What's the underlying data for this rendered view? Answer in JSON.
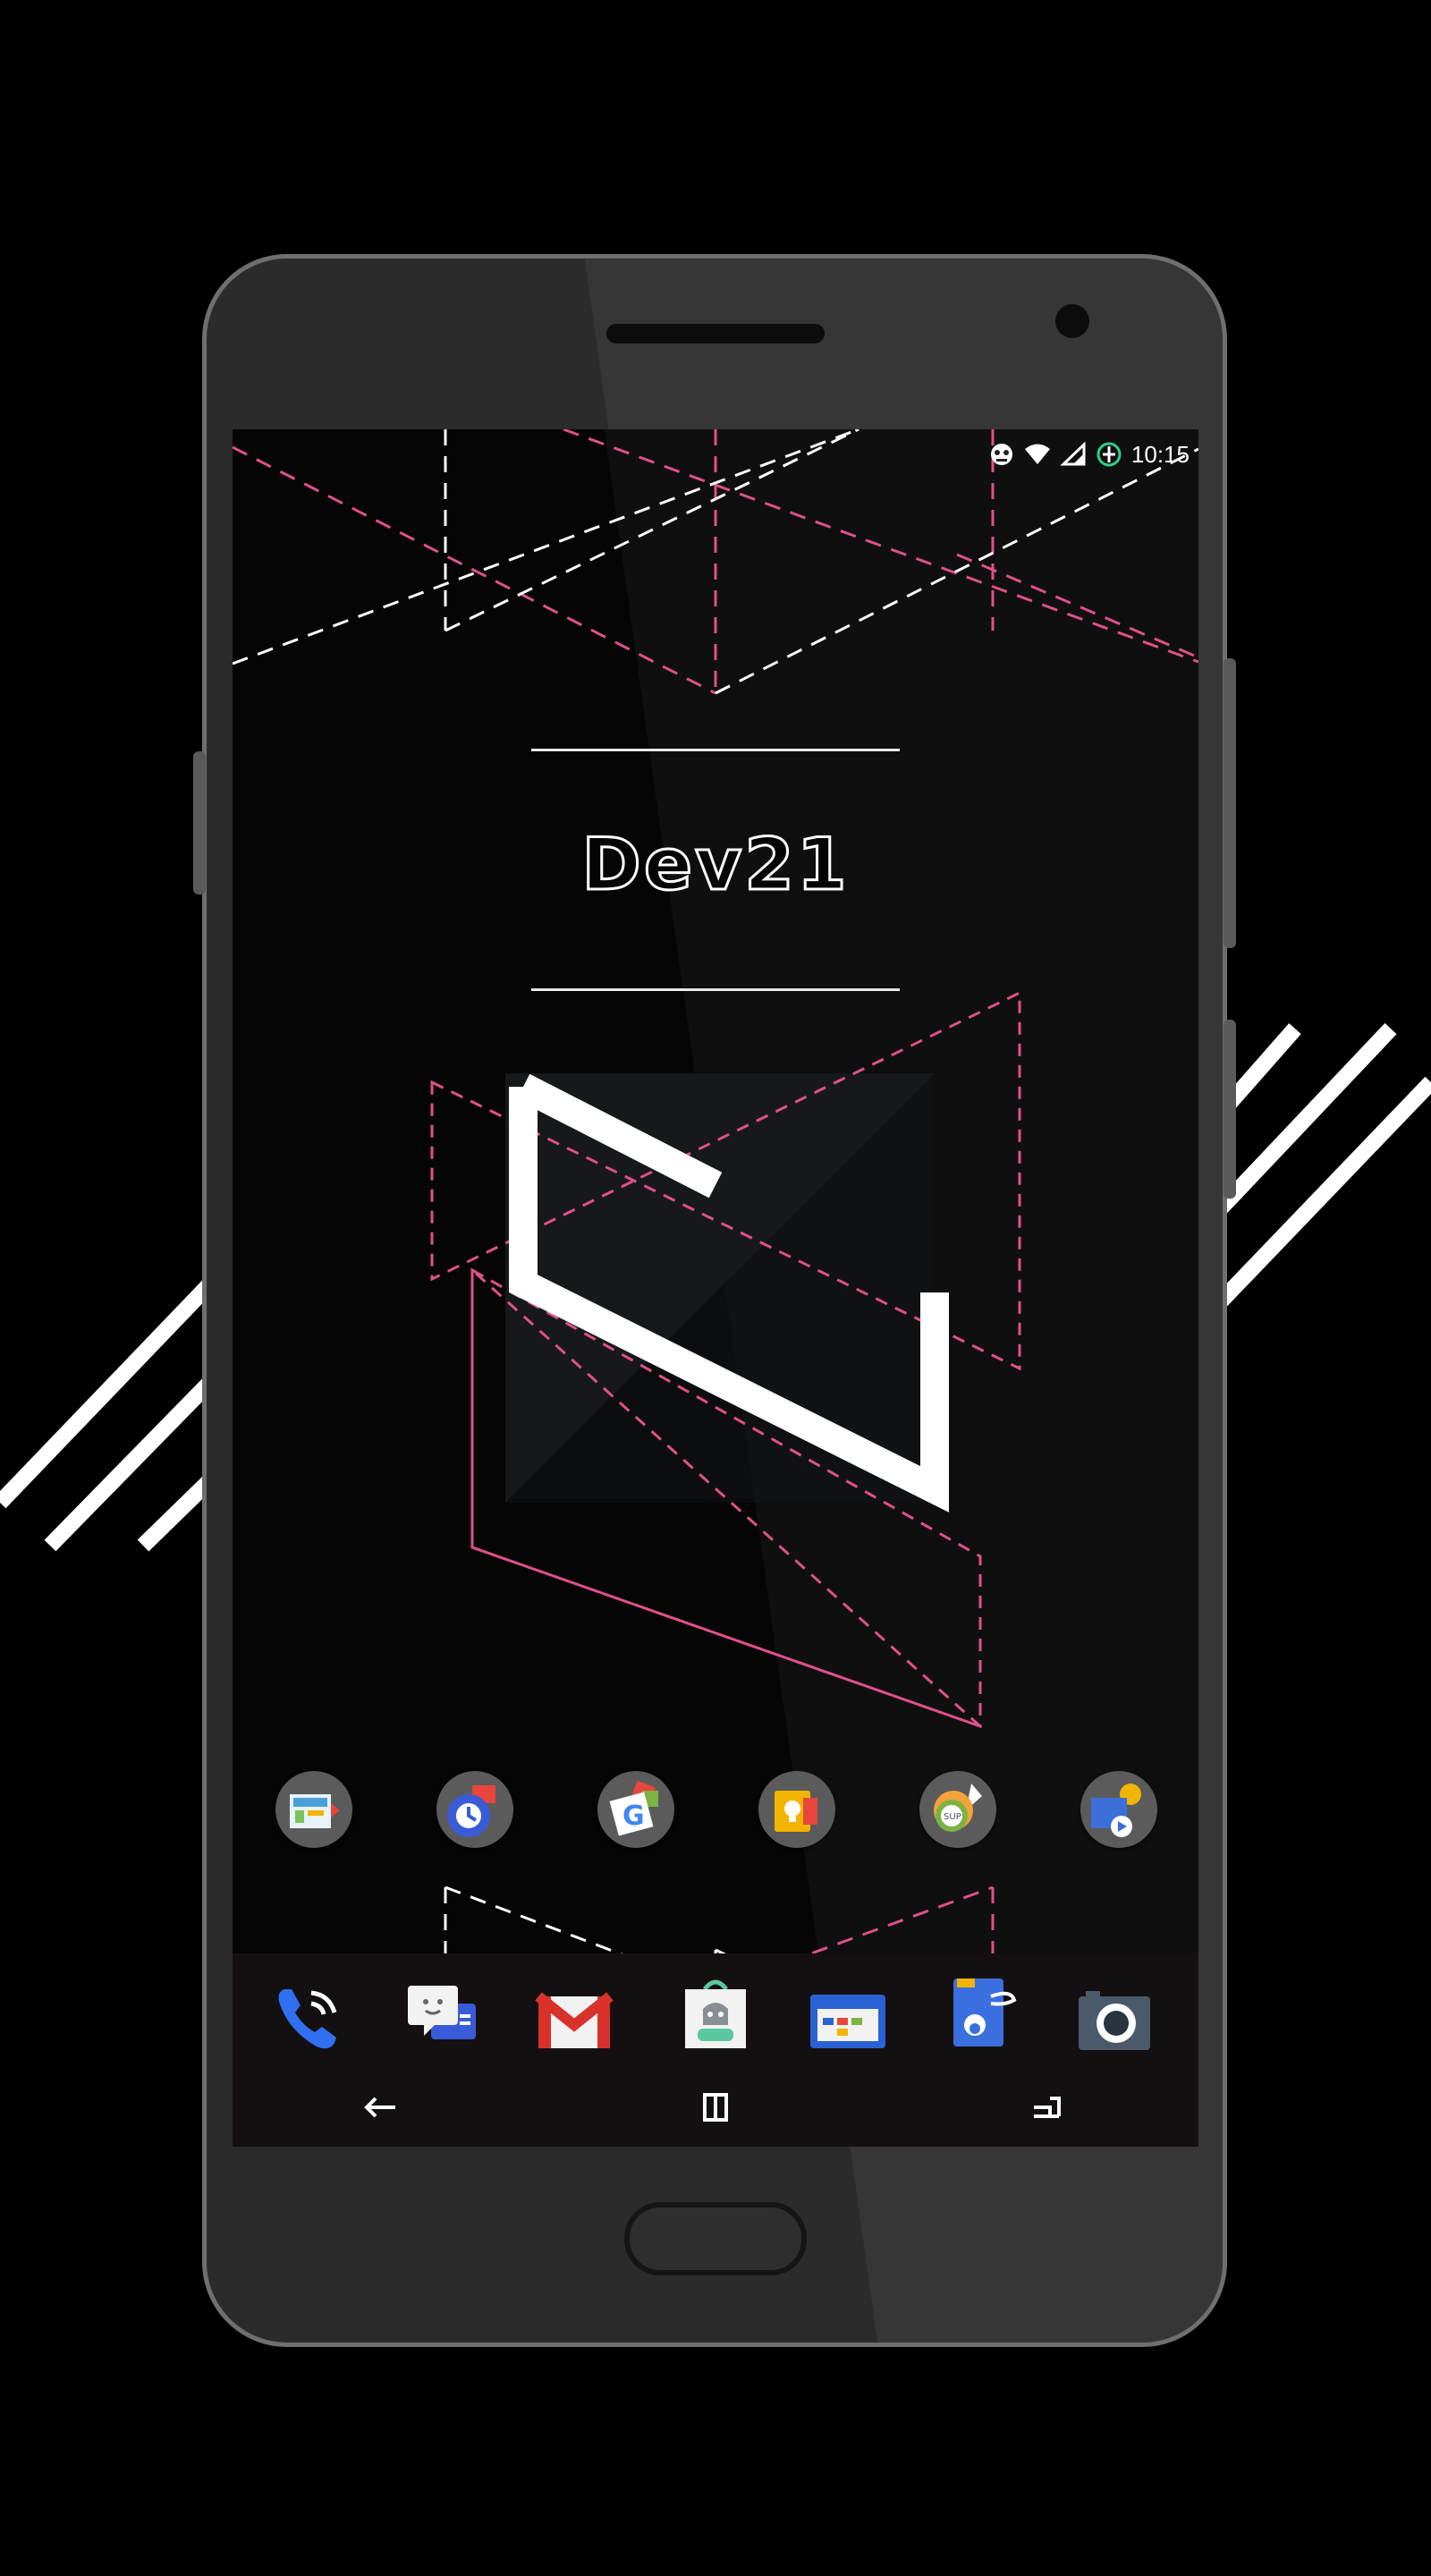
{
  "status_bar": {
    "time": "10:15",
    "icons": [
      "notification-face-icon",
      "wifi-icon",
      "cell-signal-icon",
      "battery-charging-icon"
    ]
  },
  "home": {
    "title": "Dev21"
  },
  "app_row": {
    "items": [
      {
        "icon": "maps-app-icon",
        "accent": "#4aa0d8"
      },
      {
        "icon": "clock-app-icon",
        "accent": "#3b5bd6"
      },
      {
        "icon": "google-app-icon",
        "accent": "#e8453c"
      },
      {
        "icon": "keep-notes-icon",
        "accent": "#f2b400"
      },
      {
        "icon": "sup-messenger-icon",
        "accent": "#7cb342"
      },
      {
        "icon": "video-player-icon",
        "accent": "#3c6fd8"
      }
    ]
  },
  "dock": {
    "items": [
      {
        "icon": "phone-icon",
        "accent": "#2f6ff0"
      },
      {
        "icon": "messages-icon",
        "accent": "#3a5bd8"
      },
      {
        "icon": "gmail-icon",
        "accent": "#d9322b"
      },
      {
        "icon": "play-store-icon",
        "accent": "#5bc8a0"
      },
      {
        "icon": "browser-icon",
        "accent": "#2a62d6"
      },
      {
        "icon": "file-manager-icon",
        "accent": "#3a6fe0"
      },
      {
        "icon": "camera-icon",
        "accent": "#4a5a6a"
      }
    ]
  },
  "nav_bar": {
    "buttons": [
      "back-icon",
      "home-icon",
      "recents-icon"
    ]
  },
  "colors": {
    "accent_pink": "#e0508a",
    "line_white": "#ffffff",
    "screen_bg": "#050505",
    "dock_bg": "#140f10"
  }
}
